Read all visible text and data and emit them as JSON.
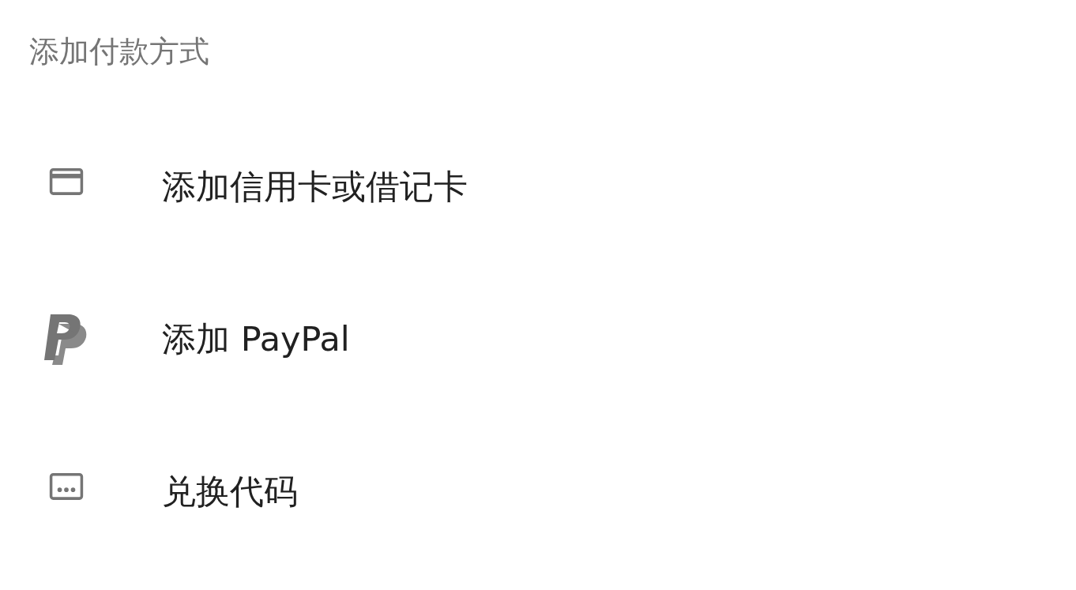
{
  "title": "添加付款方式",
  "items": [
    {
      "kind": "card",
      "label": "添加信用卡或借记卡"
    },
    {
      "kind": "paypal",
      "label": "添加 PayPal"
    },
    {
      "kind": "code",
      "label": "兑换代码"
    }
  ]
}
